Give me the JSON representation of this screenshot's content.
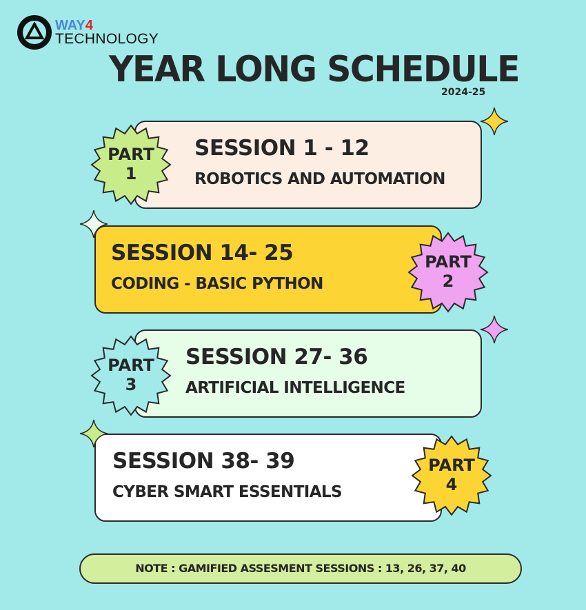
{
  "logo": {
    "line1": "WAY",
    "line1_num": "4",
    "line2": "TECHNOLOGY"
  },
  "title": "YEAR LONG SCHEDULE",
  "year": "2024-25",
  "parts": [
    {
      "badge_line1": "PART",
      "badge_line2": "1",
      "session": "SESSION 1 - 12",
      "topic": "ROBOTICS AND AUTOMATION",
      "card_color": "#fdeee3",
      "badge_color": "#c9ec8a",
      "sparkle_color": "#fcd535"
    },
    {
      "badge_line1": "PART",
      "badge_line2": "2",
      "session": "SESSION 14- 25",
      "topic": "CODING - BASIC PYTHON",
      "card_color": "#fcd535",
      "badge_color": "#f0a3f0",
      "sparkle_color": "#e9fbef"
    },
    {
      "badge_line1": "PART",
      "badge_line2": "3",
      "session": "SESSION 27- 36",
      "topic": "ARTIFICIAL INTELLIGENCE",
      "card_color": "#e6fde8",
      "badge_color": "#a2eaea",
      "sparkle_color": "#f0a3f0"
    },
    {
      "badge_line1": "PART",
      "badge_line2": "4",
      "session": "SESSION 38- 39",
      "topic": "CYBER SMART ESSENTIALS",
      "card_color": "#ffffff",
      "badge_color": "#fcd535",
      "sparkle_color": "#c9ec8a"
    }
  ],
  "note": "NOTE : GAMIFIED ASSESMENT  SESSIONS : 13, 26, 37, 40"
}
